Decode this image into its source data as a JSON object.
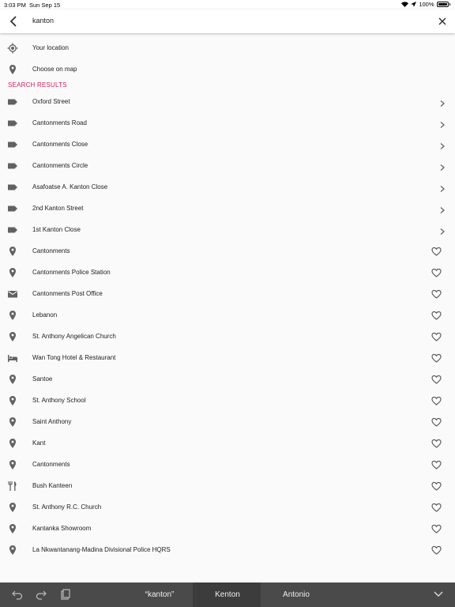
{
  "status": {
    "time": "3:03 PM",
    "date": "Sun Sep 15",
    "battery": "100%"
  },
  "search": {
    "query": "kanton"
  },
  "quick_actions": [
    {
      "label": "Your location",
      "icon": "my-location-icon"
    },
    {
      "label": "Choose on map",
      "icon": "pin-icon"
    }
  ],
  "section_header": "SEARCH RESULTS",
  "street_results": [
    {
      "label": "Oxford Street",
      "icon": "label-icon"
    },
    {
      "label": "Cantonments Road",
      "icon": "label-icon"
    },
    {
      "label": "Cantonments Close",
      "icon": "label-icon"
    },
    {
      "label": "Cantonments Circle",
      "icon": "label-icon"
    },
    {
      "label": "Asafoatse A. Kanton Close",
      "icon": "label-icon"
    },
    {
      "label": "2nd Kanton Street",
      "icon": "label-icon"
    },
    {
      "label": "1st Kanton Close",
      "icon": "label-icon"
    }
  ],
  "place_results": [
    {
      "label": "Cantonments",
      "icon": "pin-icon"
    },
    {
      "label": "Cantonments Police Station",
      "icon": "pin-icon"
    },
    {
      "label": "Cantonments Post Office",
      "icon": "mail-icon"
    },
    {
      "label": "Lebanon",
      "icon": "pin-icon"
    },
    {
      "label": "St. Anthony Angelican Church",
      "icon": "pin-icon"
    },
    {
      "label": "Wan Tong Hotel & Restaurant",
      "icon": "bed-icon"
    },
    {
      "label": "Santoe",
      "icon": "pin-icon"
    },
    {
      "label": "St. Anthony School",
      "icon": "pin-icon"
    },
    {
      "label": "Saint Anthony",
      "icon": "pin-icon"
    },
    {
      "label": "Kant",
      "icon": "pin-icon"
    },
    {
      "label": "Cantonments",
      "icon": "pin-icon"
    },
    {
      "label": "Bush Kanteen",
      "icon": "restaurant-icon"
    },
    {
      "label": "St. Anthony R.C. Church",
      "icon": "pin-icon"
    },
    {
      "label": "Kantanka Showroom",
      "icon": "pin-icon"
    },
    {
      "label": "La Nkwantanang-Madina Divisional Police HQRS",
      "icon": "pin-icon"
    }
  ],
  "keyboard_bar": {
    "suggestions": [
      "“kanton”",
      "Kenton",
      "Antonio"
    ]
  },
  "colors": {
    "accent": "#d81b60",
    "icon": "#616161",
    "keyboard_bg": "#4a4a4a"
  }
}
